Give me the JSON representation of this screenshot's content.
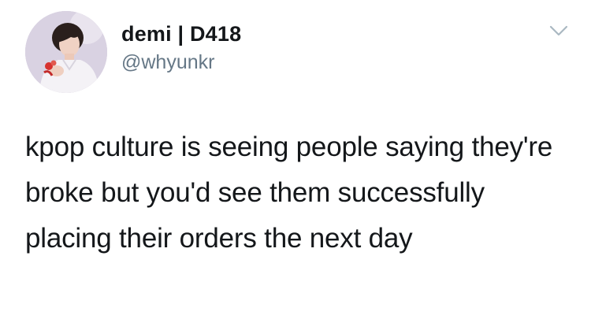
{
  "tweet": {
    "author": {
      "display_name": "demi | D418",
      "handle": "@whyunkr",
      "avatar_icon": "profile-photo"
    },
    "menu_icon": "chevron-down-icon",
    "text": "kpop culture is seeing people saying they're broke but you'd see them successfully placing their orders the next day"
  },
  "colors": {
    "background": "#ffffff",
    "text_primary": "#14171a",
    "text_secondary": "#657786",
    "chevron": "#aab8c2"
  }
}
